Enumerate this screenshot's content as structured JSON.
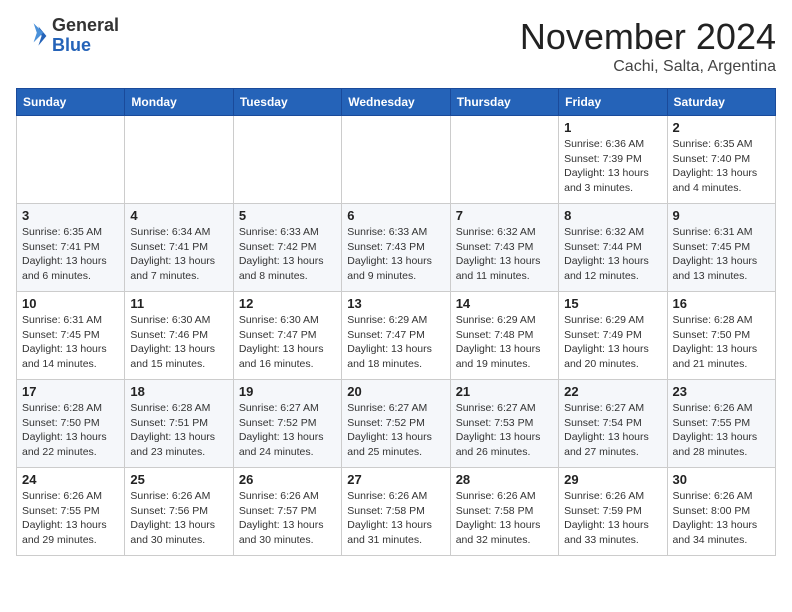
{
  "header": {
    "logo_general": "General",
    "logo_blue": "Blue",
    "month_title": "November 2024",
    "location": "Cachi, Salta, Argentina"
  },
  "weekdays": [
    "Sunday",
    "Monday",
    "Tuesday",
    "Wednesday",
    "Thursday",
    "Friday",
    "Saturday"
  ],
  "weeks": [
    [
      {
        "day": "",
        "info": ""
      },
      {
        "day": "",
        "info": ""
      },
      {
        "day": "",
        "info": ""
      },
      {
        "day": "",
        "info": ""
      },
      {
        "day": "",
        "info": ""
      },
      {
        "day": "1",
        "info": "Sunrise: 6:36 AM\nSunset: 7:39 PM\nDaylight: 13 hours and 3 minutes."
      },
      {
        "day": "2",
        "info": "Sunrise: 6:35 AM\nSunset: 7:40 PM\nDaylight: 13 hours and 4 minutes."
      }
    ],
    [
      {
        "day": "3",
        "info": "Sunrise: 6:35 AM\nSunset: 7:41 PM\nDaylight: 13 hours and 6 minutes."
      },
      {
        "day": "4",
        "info": "Sunrise: 6:34 AM\nSunset: 7:41 PM\nDaylight: 13 hours and 7 minutes."
      },
      {
        "day": "5",
        "info": "Sunrise: 6:33 AM\nSunset: 7:42 PM\nDaylight: 13 hours and 8 minutes."
      },
      {
        "day": "6",
        "info": "Sunrise: 6:33 AM\nSunset: 7:43 PM\nDaylight: 13 hours and 9 minutes."
      },
      {
        "day": "7",
        "info": "Sunrise: 6:32 AM\nSunset: 7:43 PM\nDaylight: 13 hours and 11 minutes."
      },
      {
        "day": "8",
        "info": "Sunrise: 6:32 AM\nSunset: 7:44 PM\nDaylight: 13 hours and 12 minutes."
      },
      {
        "day": "9",
        "info": "Sunrise: 6:31 AM\nSunset: 7:45 PM\nDaylight: 13 hours and 13 minutes."
      }
    ],
    [
      {
        "day": "10",
        "info": "Sunrise: 6:31 AM\nSunset: 7:45 PM\nDaylight: 13 hours and 14 minutes."
      },
      {
        "day": "11",
        "info": "Sunrise: 6:30 AM\nSunset: 7:46 PM\nDaylight: 13 hours and 15 minutes."
      },
      {
        "day": "12",
        "info": "Sunrise: 6:30 AM\nSunset: 7:47 PM\nDaylight: 13 hours and 16 minutes."
      },
      {
        "day": "13",
        "info": "Sunrise: 6:29 AM\nSunset: 7:47 PM\nDaylight: 13 hours and 18 minutes."
      },
      {
        "day": "14",
        "info": "Sunrise: 6:29 AM\nSunset: 7:48 PM\nDaylight: 13 hours and 19 minutes."
      },
      {
        "day": "15",
        "info": "Sunrise: 6:29 AM\nSunset: 7:49 PM\nDaylight: 13 hours and 20 minutes."
      },
      {
        "day": "16",
        "info": "Sunrise: 6:28 AM\nSunset: 7:50 PM\nDaylight: 13 hours and 21 minutes."
      }
    ],
    [
      {
        "day": "17",
        "info": "Sunrise: 6:28 AM\nSunset: 7:50 PM\nDaylight: 13 hours and 22 minutes."
      },
      {
        "day": "18",
        "info": "Sunrise: 6:28 AM\nSunset: 7:51 PM\nDaylight: 13 hours and 23 minutes."
      },
      {
        "day": "19",
        "info": "Sunrise: 6:27 AM\nSunset: 7:52 PM\nDaylight: 13 hours and 24 minutes."
      },
      {
        "day": "20",
        "info": "Sunrise: 6:27 AM\nSunset: 7:52 PM\nDaylight: 13 hours and 25 minutes."
      },
      {
        "day": "21",
        "info": "Sunrise: 6:27 AM\nSunset: 7:53 PM\nDaylight: 13 hours and 26 minutes."
      },
      {
        "day": "22",
        "info": "Sunrise: 6:27 AM\nSunset: 7:54 PM\nDaylight: 13 hours and 27 minutes."
      },
      {
        "day": "23",
        "info": "Sunrise: 6:26 AM\nSunset: 7:55 PM\nDaylight: 13 hours and 28 minutes."
      }
    ],
    [
      {
        "day": "24",
        "info": "Sunrise: 6:26 AM\nSunset: 7:55 PM\nDaylight: 13 hours and 29 minutes."
      },
      {
        "day": "25",
        "info": "Sunrise: 6:26 AM\nSunset: 7:56 PM\nDaylight: 13 hours and 30 minutes."
      },
      {
        "day": "26",
        "info": "Sunrise: 6:26 AM\nSunset: 7:57 PM\nDaylight: 13 hours and 30 minutes."
      },
      {
        "day": "27",
        "info": "Sunrise: 6:26 AM\nSunset: 7:58 PM\nDaylight: 13 hours and 31 minutes."
      },
      {
        "day": "28",
        "info": "Sunrise: 6:26 AM\nSunset: 7:58 PM\nDaylight: 13 hours and 32 minutes."
      },
      {
        "day": "29",
        "info": "Sunrise: 6:26 AM\nSunset: 7:59 PM\nDaylight: 13 hours and 33 minutes."
      },
      {
        "day": "30",
        "info": "Sunrise: 6:26 AM\nSunset: 8:00 PM\nDaylight: 13 hours and 34 minutes."
      }
    ]
  ]
}
